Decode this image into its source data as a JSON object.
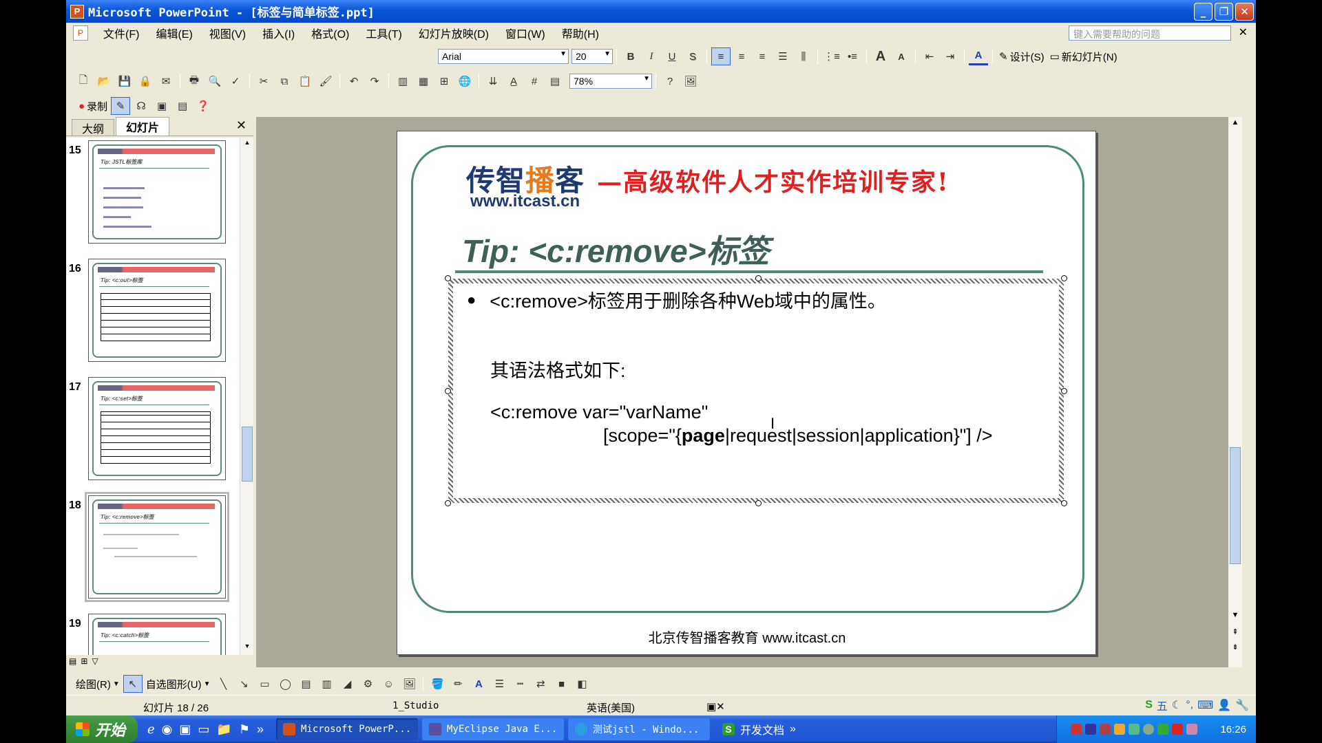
{
  "window": {
    "title": "Microsoft PowerPoint - [标签与简单标签.ppt]",
    "min": "_",
    "restore": "❐",
    "close": "✕"
  },
  "menu": {
    "items": [
      "文件(F)",
      "编辑(E)",
      "视图(V)",
      "插入(I)",
      "格式(O)",
      "工具(T)",
      "幻灯片放映(D)",
      "窗口(W)",
      "帮助(H)"
    ],
    "help_placeholder": "键入需要帮助的问题",
    "close": "✕"
  },
  "format_toolbar": {
    "font": "Arial",
    "size": "20",
    "bold": "B",
    "italic": "I",
    "underline": "U",
    "shadow": "S",
    "design": "设计(S)",
    "new_slide": "新幻灯片(N)"
  },
  "standard_toolbar": {
    "zoom": "78%"
  },
  "record_toolbar": {
    "record": "录制"
  },
  "left_panel": {
    "tabs": [
      "大纲",
      "幻灯片"
    ],
    "close": "✕",
    "thumbs": [
      {
        "num": "15",
        "tip": "Tip: JSTL标签库"
      },
      {
        "num": "16",
        "tip": "Tip: <c:out>标签"
      },
      {
        "num": "17",
        "tip": "Tip: <c:set>标签"
      },
      {
        "num": "18",
        "tip": "Tip: <c:remove>标签"
      },
      {
        "num": "19",
        "tip": "Tip: <c:catch>标签"
      }
    ]
  },
  "slide": {
    "logo_cn_a": "传智",
    "logo_cn_b": "播",
    "logo_cn_c": "客",
    "logo_url": "www.itcast.cn",
    "slogan": "—高级软件人才实作培训专家!",
    "title": "Tip: <c:remove>标签",
    "bullet": "<c:remove>标签用于删除各种Web域中的属性。",
    "syntax_label": "其语法格式如下:",
    "code_line1": "<c:remove var=\"varName\"",
    "code_line2_pre": "[scope=\"{",
    "code_line2_bold": "page",
    "code_line2_post": "|request|session|application}\"] />",
    "footer": "北京传智播客教育 www.itcast.cn"
  },
  "drawbar": {
    "draw": "绘图(R)",
    "autoshape": "自选图形(U)"
  },
  "status": {
    "slide": "幻灯片 18 / 26",
    "design": "1_Studio",
    "language": "英语(美国)"
  },
  "taskbar": {
    "start": "开始",
    "tasks": [
      "Microsoft PowerP...",
      "MyEclipse Java E...",
      "测试jstl - Windo..."
    ],
    "kdoc": "开发文档",
    "more": "»",
    "clock": "16:26"
  }
}
